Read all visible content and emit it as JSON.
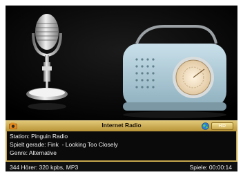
{
  "panel": {
    "title": "Internet Radio",
    "hd_badge": "HD",
    "station": "Station: Pinguin Radio",
    "playing": "Spielt gerade: Fink  - Looking Too Closely",
    "genre": "Genre: Alternative"
  },
  "status": {
    "listeners": "344 Hörer: 320 kpbs, MP3",
    "playtime": "Spiele: 00:00:14"
  },
  "icons": {
    "left": "camera-icon",
    "right": "globe-icon"
  }
}
